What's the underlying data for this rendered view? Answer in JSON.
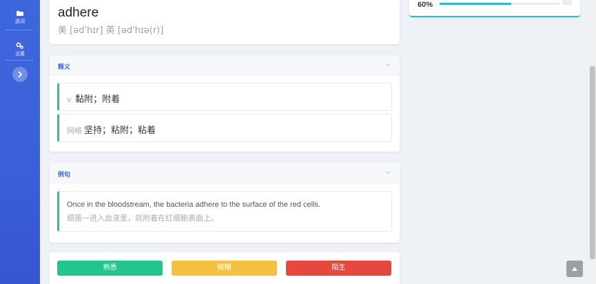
{
  "sidebar": {
    "items": [
      {
        "label": "选词",
        "icon": "folder-icon"
      },
      {
        "label": "设置",
        "icon": "gears-icon"
      }
    ],
    "toggle_icon": "chevron-right-icon"
  },
  "word": {
    "text": "adhere",
    "phonetic": "美 [əd'hɪr] 英 [əd'hɪə(r)]"
  },
  "definitions": {
    "title": "释义",
    "items": [
      {
        "pos": "v.",
        "text": "黏附；附着"
      },
      {
        "pos": "网络",
        "text": "坚持；粘附；粘着"
      }
    ]
  },
  "examples": {
    "title": "例句",
    "items": [
      {
        "en": "Once in the bloodstream, the bacteria adhere to the surface of the red cells.",
        "zh": "细菌一进入血液里，就附着在红细胞表面上。"
      }
    ]
  },
  "buttons": {
    "know": "熟悉",
    "vague": "模糊",
    "unknown": "陌生"
  },
  "progress": {
    "percent_label": "60%",
    "value": 0.6
  },
  "colors": {
    "accent": "#3a5fd8",
    "know": "#22c58b",
    "vague": "#f6c13f",
    "unknown": "#e8473d",
    "item_border": "#26c48d"
  }
}
